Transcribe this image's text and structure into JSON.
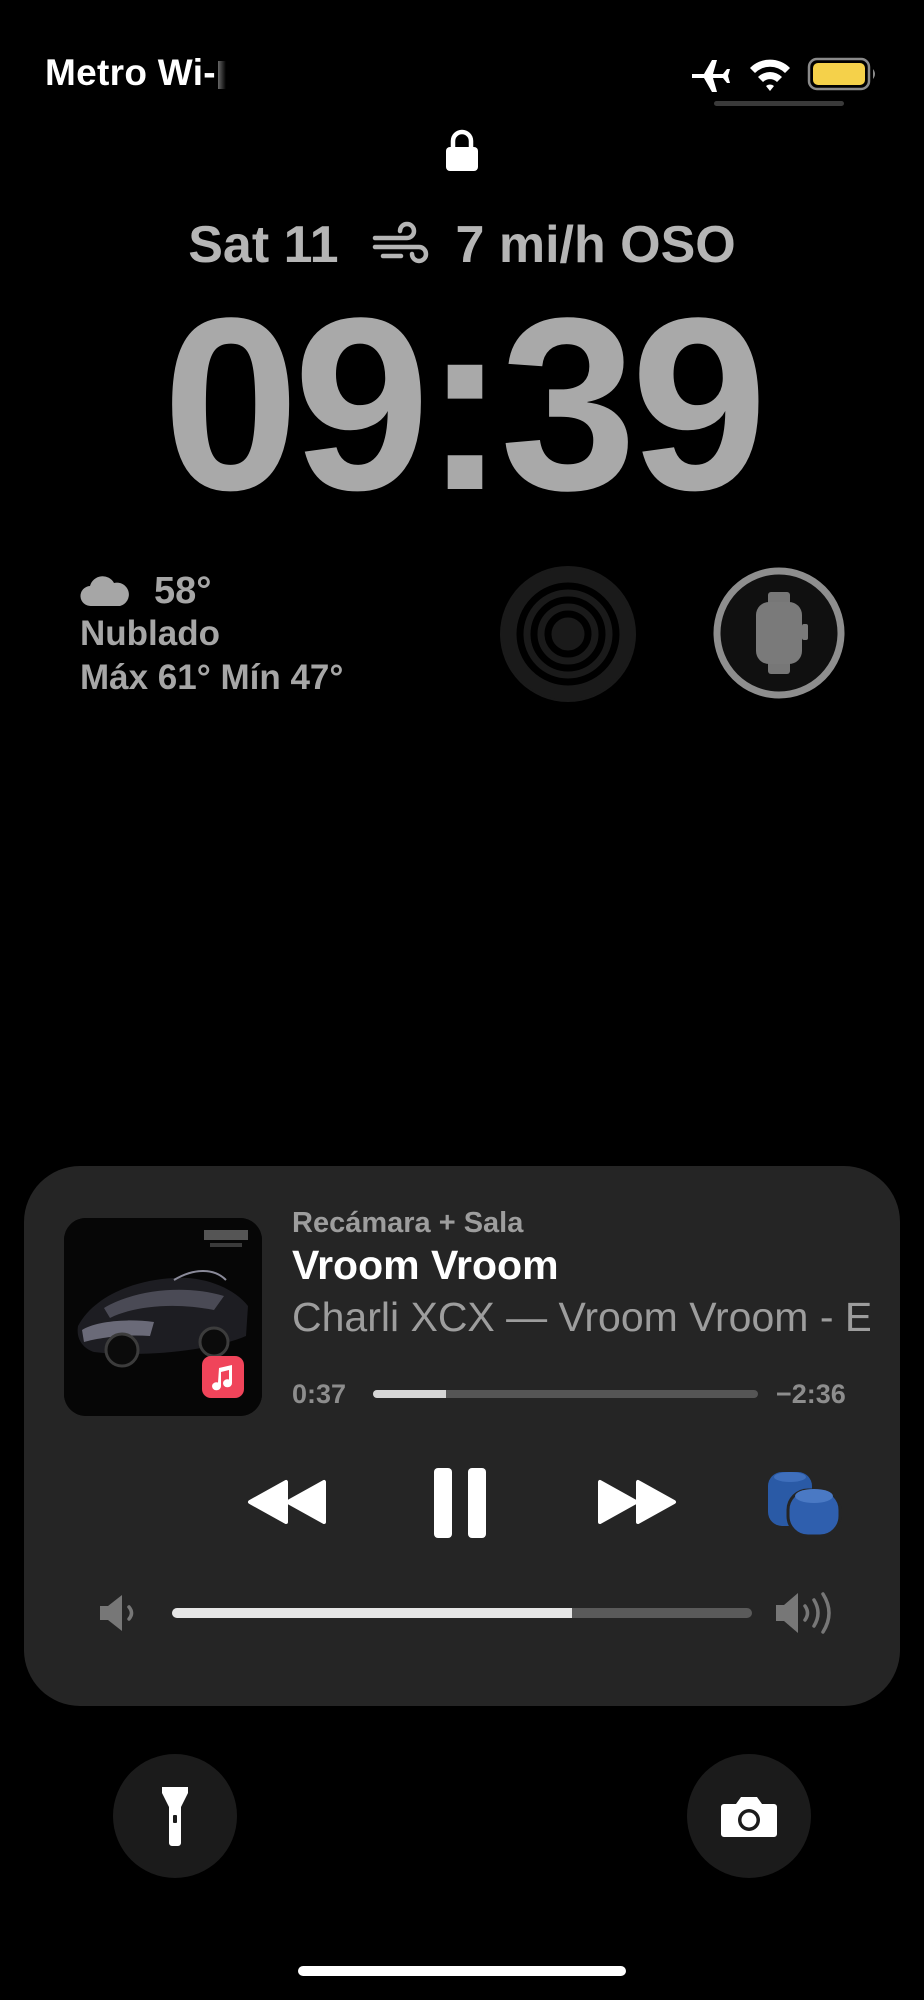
{
  "status_bar": {
    "carrier": "Metro Wi-",
    "icons": [
      "airplane-icon",
      "wifi-icon",
      "battery-icon"
    ],
    "battery_color": "#f5d14a"
  },
  "lock": {
    "icon": "lock-icon"
  },
  "date_widget": {
    "date": "Sat 11",
    "wind_icon": "wind-icon",
    "wind": "7 mi/h OSO"
  },
  "clock": {
    "time": "09:39"
  },
  "weather_widget": {
    "icon": "cloud-icon",
    "temperature": "58°",
    "condition": "Nublado",
    "high_low": "Máx 61° Mín 47°"
  },
  "widgets": {
    "activity_icon": "activity-rings-icon",
    "watch_icon": "watch-battery-icon"
  },
  "now_playing": {
    "device": "Recámara + Sala",
    "title": "Vroom Vroom",
    "artist": "Charli XCX — Vroom Vroom - EP",
    "elapsed": "0:37",
    "remaining": "−2:36",
    "progress": 0.19,
    "volume": 0.69,
    "app_badge_icon": "apple-music-icon",
    "accent": "#2f5fae",
    "controls": [
      "rewind-icon",
      "pause-icon",
      "forward-icon",
      "homepod-icon"
    ]
  },
  "quick_actions": {
    "left": "flashlight-icon",
    "right": "camera-icon"
  }
}
